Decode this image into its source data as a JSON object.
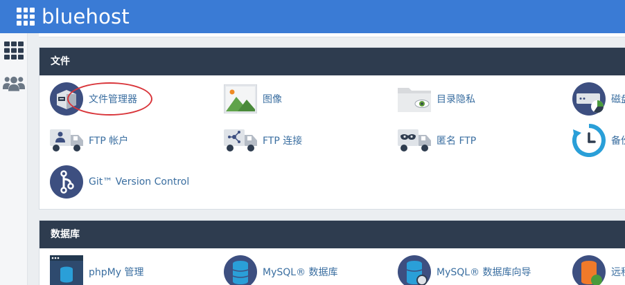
{
  "brand": {
    "name": "bluehost"
  },
  "sections": {
    "files": {
      "title": "文件",
      "items": [
        {
          "label": "文件管理器",
          "icon": "file-manager-icon"
        },
        {
          "label": "图像",
          "icon": "images-icon"
        },
        {
          "label": "目录隐私",
          "icon": "directory-privacy-icon"
        },
        {
          "label": "磁盘",
          "icon": "disk-usage-icon"
        },
        {
          "label": "FTP 帐户",
          "icon": "ftp-accounts-icon"
        },
        {
          "label": "FTP 连接",
          "icon": "ftp-connections-icon"
        },
        {
          "label": "匿名 FTP",
          "icon": "anonymous-ftp-icon"
        },
        {
          "label": "备份",
          "icon": "backup-icon"
        },
        {
          "label": "Git™ Version Control",
          "icon": "git-icon"
        }
      ]
    },
    "databases": {
      "title": "数据库",
      "items": [
        {
          "label": "phpMy 管理",
          "icon": "phpmyadmin-icon"
        },
        {
          "label": "MySQL® 数据库",
          "icon": "mysql-databases-icon"
        },
        {
          "label": "MySQL® 数据库向导",
          "icon": "mysql-wizard-icon"
        },
        {
          "label": "远程",
          "icon": "remote-mysql-icon"
        }
      ]
    }
  },
  "colors": {
    "topbar": "#3a7bd5",
    "panel_header": "#2e3c4f",
    "link": "#3a6ea0",
    "highlight": "#d9353a"
  }
}
